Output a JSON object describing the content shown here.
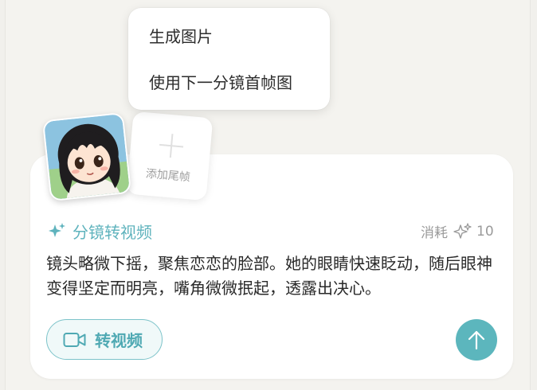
{
  "menu": {
    "items": [
      {
        "label": "生成图片"
      },
      {
        "label": "使用下一分镜首帧图"
      }
    ]
  },
  "frames": {
    "add_tail_label": "添加尾帧"
  },
  "storyboard": {
    "title": "分镜转视频",
    "cost_label": "消耗",
    "cost_value": "10",
    "description": "镜头略微下摇，聚焦恋恋的脸部。她的眼睛快速眨动，随后眼神变得坚定而明亮，嘴角微微抿起，透露出决心。"
  },
  "actions": {
    "convert_label": "转视频"
  },
  "colors": {
    "accent": "#5fb3bd",
    "send_button": "#5cb6bd",
    "background": "#f1f0ec"
  }
}
